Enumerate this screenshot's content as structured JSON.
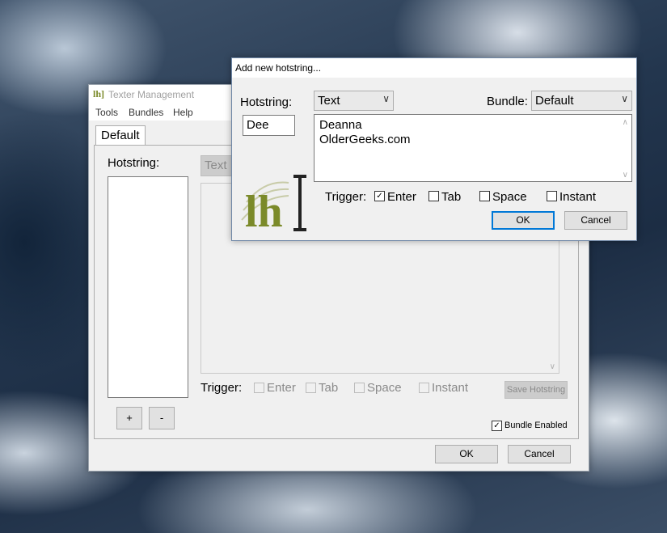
{
  "management": {
    "title": "Texter Management",
    "icon": "lh-logo-icon",
    "menu": [
      "Tools",
      "Bundles",
      "Help"
    ],
    "tab": "Default",
    "hotstring_label": "Hotstring:",
    "type_value": "Text",
    "trigger_label": "Trigger:",
    "triggers": [
      {
        "label": "Enter",
        "checked": false
      },
      {
        "label": "Tab",
        "checked": false
      },
      {
        "label": "Space",
        "checked": false
      },
      {
        "label": "Instant",
        "checked": false
      }
    ],
    "save_label": "Save Hotstring",
    "add_label": "+",
    "remove_label": "-",
    "bundle_enabled_label": "Bundle Enabled",
    "bundle_enabled": true,
    "ok_label": "OK",
    "cancel_label": "Cancel"
  },
  "dialog": {
    "title": "Add new hotstring...",
    "hotstring_label": "Hotstring:",
    "hotstring_value": "Dee",
    "type_value": "Text",
    "bundle_label": "Bundle:",
    "bundle_value": "Default",
    "text_lines": [
      "Deanna",
      "OlderGeeks.com"
    ],
    "trigger_label": "Trigger:",
    "triggers": [
      {
        "label": "Enter",
        "checked": true
      },
      {
        "label": "Tab",
        "checked": false
      },
      {
        "label": "Space",
        "checked": false
      },
      {
        "label": "Instant",
        "checked": false
      }
    ],
    "ok_label": "OK",
    "cancel_label": "Cancel"
  },
  "colors": {
    "accent": "#0078d7",
    "logo_green": "#7b8a2a"
  }
}
